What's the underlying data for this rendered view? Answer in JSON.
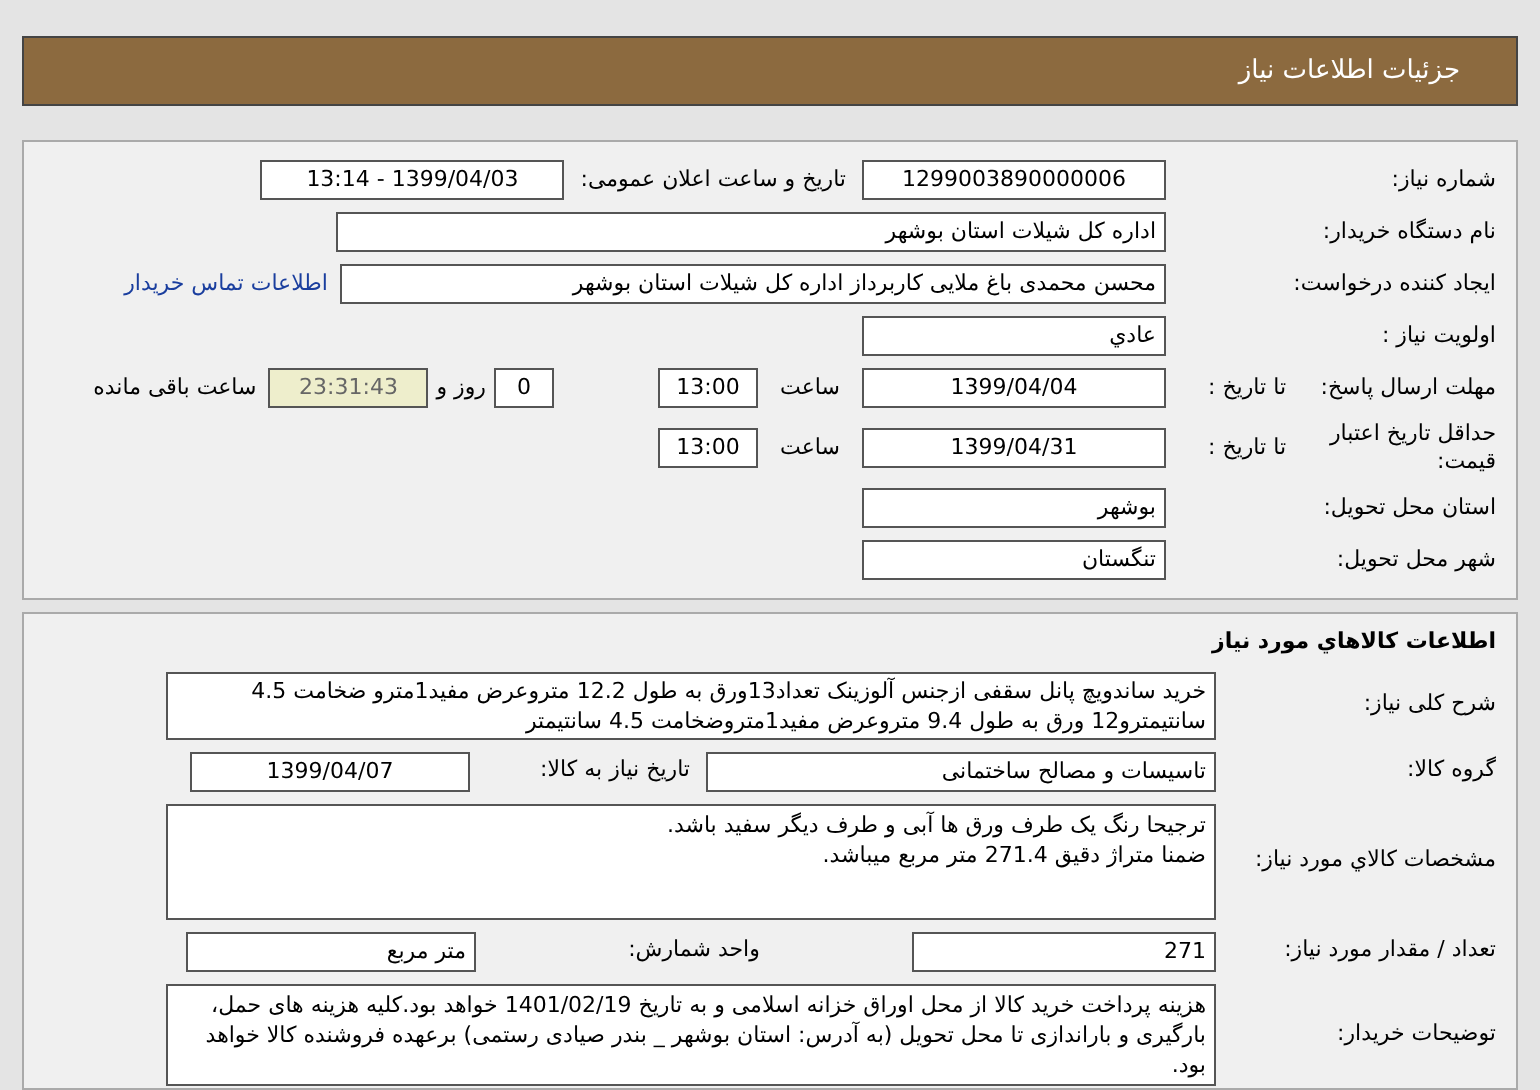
{
  "header": {
    "title": "جزئیات اطلاعات نیاز"
  },
  "need": {
    "number_label": "شماره نیاز:",
    "number": "1299003890000006",
    "announce_label": "تاریخ و ساعت اعلان عمومی:",
    "announce": "1399/04/03 - 13:14",
    "buyer_label": "نام دستگاه خریدار:",
    "buyer": "اداره کل شیلات استان بوشهر",
    "creator_label": "ایجاد کننده درخواست:",
    "creator": "محسن محمدی باغ ملایی کاربرداز اداره کل شیلات استان بوشهر",
    "contact_link": "اطلاعات تماس خریدار",
    "priority_label": "اولویت نیاز :",
    "priority": "عادي",
    "deadline_label": "مهلت ارسال پاسخ:",
    "deadline_to": "تا تاریخ :",
    "deadline_date": "1399/04/04",
    "deadline_time_label": "ساعت",
    "deadline_time": "13:00",
    "days": "0",
    "days_label": "روز و",
    "remaining": "23:31:43",
    "remaining_label": "ساعت باقی مانده",
    "validity_label": "حداقل تاریخ اعتبار قیمت:",
    "validity_to": "تا تاریخ :",
    "validity_date": "1399/04/31",
    "validity_time_label": "ساعت",
    "validity_time": "13:00",
    "province_label": "استان محل تحویل:",
    "province": "بوشهر",
    "city_label": "شهر محل تحویل:",
    "city": "تنگستان"
  },
  "goods": {
    "title": "اطلاعات کالاهاي مورد نياز",
    "summary_label": "شرح کلی نیاز:",
    "summary": "خرید ساندویچ پانل سقفی ازجنس آلوزینک تعداد13ورق به طول 12.2 متروعرض مفید1مترو ضخامت 4.5 سانتیمترو12 ورق به طول 9.4 متروعرض مفید1متروضخامت 4.5 سانتیمتر",
    "group_label": "گروه کالا:",
    "group": "تاسیسات و مصالح ساختمانی",
    "need_date_label": "تاریخ نیاز به کالا:",
    "need_date": "1399/04/07",
    "spec_label": "مشخصات کالاي مورد نياز:",
    "spec_lines": [
      "ترجیحا رنگ یک طرف ورق ها آبی و طرف دیگر سفید باشد.",
      "ضمنا متراژ دقیق 271.4 متر مربع میباشد."
    ],
    "qty_label": "تعداد / مقدار مورد نیاز:",
    "qty": "271",
    "unit_label": "واحد شمارش:",
    "unit": "متر مربع",
    "notes_label": "توضیحات خریدار:",
    "notes": "هزینه پرداخت خرید کالا از محل اوراق خزانه اسلامی و به تاریخ 1401/02/19 خواهد بود.کلیه هزینه های حمل، بارگیری و باراندازی تا محل تحویل (به آدرس: استان بوشهر _ بندر صیادی رستمی) برعهده فروشنده کالا خواهد بود."
  }
}
